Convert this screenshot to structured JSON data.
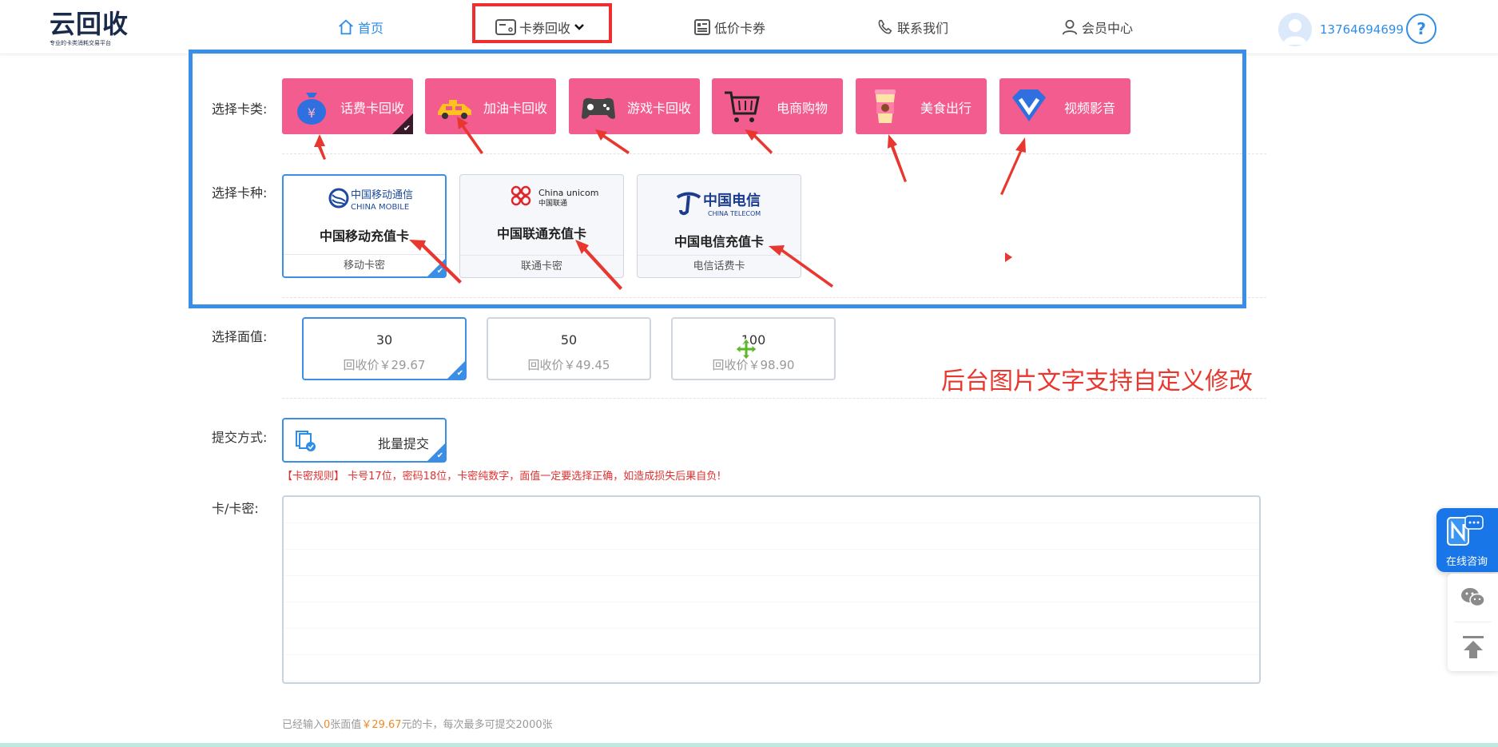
{
  "header": {
    "logo_main": "云回收",
    "logo_sub": "专业的卡类消耗交易平台",
    "nav": [
      {
        "label": "首页",
        "icon": "home-icon",
        "active": true
      },
      {
        "label": "卡券回收",
        "icon": "card-icon",
        "active": false
      },
      {
        "label": "低价卡券",
        "icon": "voucher-icon",
        "active": false
      },
      {
        "label": "联系我们",
        "icon": "phone-icon",
        "active": false
      },
      {
        "label": "会员中心",
        "icon": "user-icon",
        "active": false
      }
    ],
    "phone": "13764694699",
    "help_label": "?"
  },
  "form": {
    "category_label": "选择卡类:",
    "categories": [
      {
        "label": "话费卡回收",
        "icon": "money-bag-icon",
        "selected": true
      },
      {
        "label": "加油卡回收",
        "icon": "car-icon",
        "selected": false
      },
      {
        "label": "游戏卡回收",
        "icon": "gamepad-icon",
        "selected": false
      },
      {
        "label": "电商购物",
        "icon": "cart-icon",
        "selected": false
      },
      {
        "label": "美食出行",
        "icon": "coffee-icon",
        "selected": false
      },
      {
        "label": "视频影音",
        "icon": "video-v-icon",
        "selected": false
      }
    ],
    "type_label": "选择卡种:",
    "types": [
      {
        "logo_cn": "中国移动通信",
        "logo_en": "CHINA MOBILE",
        "name": "中国移动充值卡",
        "sub": "移动卡密",
        "selected": true
      },
      {
        "logo_cn": "中国联通",
        "logo_en": "China unicom",
        "name": "中国联通充值卡",
        "sub": "联通卡密",
        "selected": false
      },
      {
        "logo_cn": "中国电信",
        "logo_en": "CHINA TELECOM",
        "name": "中国电信充值卡",
        "sub": "电信话费卡",
        "selected": false
      }
    ],
    "value_label": "选择面值:",
    "values": [
      {
        "amount": "30",
        "price": "回收价￥29.67",
        "selected": true
      },
      {
        "amount": "50",
        "price": "回收价￥49.45",
        "selected": false
      },
      {
        "amount": "100",
        "price": "回收价￥98.90",
        "selected": false
      }
    ],
    "submit_label": "提交方式:",
    "submit_option": "批量提交",
    "rule_text": "【卡密规则】 卡号17位，密码18位，卡密纯数字，面值一定要选择正确，如造成损失后果自负!",
    "card_label": "卡/卡密:",
    "stats": {
      "prefix": "已经输入",
      "count": "0",
      "mid": "张面值",
      "amount": "￥29.67",
      "suffix": "元的卡，每次最多可提交2000张"
    }
  },
  "annotation": {
    "custom_note": "后台图片文字支持自定义修改"
  },
  "float": {
    "consult_label": "在线咨询",
    "wechat_icon": "wechat-icon",
    "top_icon": "back-to-top-icon"
  },
  "colors": {
    "accent": "#2e8ee6",
    "category_bg": "#f25c8f",
    "annotation_red": "#e8372e",
    "price_orange": "#f08a24"
  }
}
